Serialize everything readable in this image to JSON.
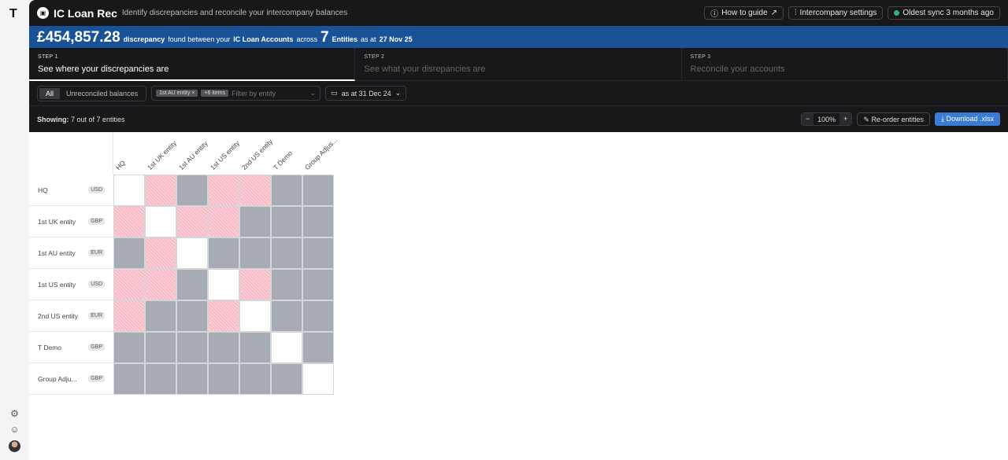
{
  "sidebar": {
    "logo": "T",
    "icons": [
      "gear-icon",
      "support-icon",
      "avatar"
    ]
  },
  "header": {
    "title": "IC Loan Rec",
    "subtitle": "Identify discrepancies and reconcile your intercompany balances",
    "how_to": "How to guide",
    "settings": "Intercompany settings",
    "sync": "Oldest sync 3 months ago",
    "sync_color": "#2bb673"
  },
  "banner": {
    "amount": "£454,857.28",
    "t1": "discrepancy",
    "t2": "found between your",
    "t3": "IC Loan Accounts",
    "t4": "across",
    "count": "7",
    "t5": "Entities",
    "t6": "as at",
    "date": "27 Nov 25"
  },
  "steps": [
    {
      "k": "STEP 1",
      "t": "See where your discrepancies are"
    },
    {
      "k": "STEP 2",
      "t": "See what your disrepancies are"
    },
    {
      "k": "STEP 3",
      "t": "Reconcile your accounts"
    }
  ],
  "filters": {
    "seg_all": "All",
    "seg_unrec": "Unreconciled balances",
    "chip1": "1st AU entity ×",
    "chip2": "+6 items",
    "placeholder": "Filter by entity",
    "date": "as at 31 Dec 24"
  },
  "showing": {
    "label": "Showing:",
    "value": "7 out of 7 entities",
    "zoom": "100%",
    "minus": "−",
    "plus": "+",
    "reorder": "Re-order entities",
    "download": "Download .xlsx"
  },
  "matrix": {
    "columns": [
      "HQ",
      "1st UK entity",
      "1st AU entity",
      "1st US entity",
      "2nd US entity",
      "T Demo",
      "Group Adjus..."
    ],
    "rows": [
      {
        "name": "HQ",
        "cur": "USD"
      },
      {
        "name": "1st UK entity",
        "cur": "GBP"
      },
      {
        "name": "1st AU entity",
        "cur": "EUR"
      },
      {
        "name": "1st US entity",
        "cur": "USD"
      },
      {
        "name": "2nd US entity",
        "cur": "EUR"
      },
      {
        "name": "T Demo",
        "cur": "GBP"
      },
      {
        "name": "Group Adju...",
        "cur": "GBP"
      }
    ],
    "status": [
      [
        "self",
        "discrepancy",
        "none",
        "discrepancy",
        "discrepancy",
        "none",
        "none"
      ],
      [
        "discrepancy",
        "self",
        "discrepancy",
        "discrepancy",
        "none",
        "none",
        "none"
      ],
      [
        "none",
        "discrepancy",
        "self",
        "none",
        "none",
        "none",
        "none"
      ],
      [
        "discrepancy",
        "discrepancy",
        "none",
        "self",
        "discrepancy",
        "none",
        "none"
      ],
      [
        "discrepancy",
        "none",
        "none",
        "discrepancy",
        "self",
        "none",
        "none"
      ],
      [
        "none",
        "none",
        "none",
        "none",
        "none",
        "self",
        "none"
      ],
      [
        "none",
        "none",
        "none",
        "none",
        "none",
        "none",
        "self"
      ]
    ]
  }
}
